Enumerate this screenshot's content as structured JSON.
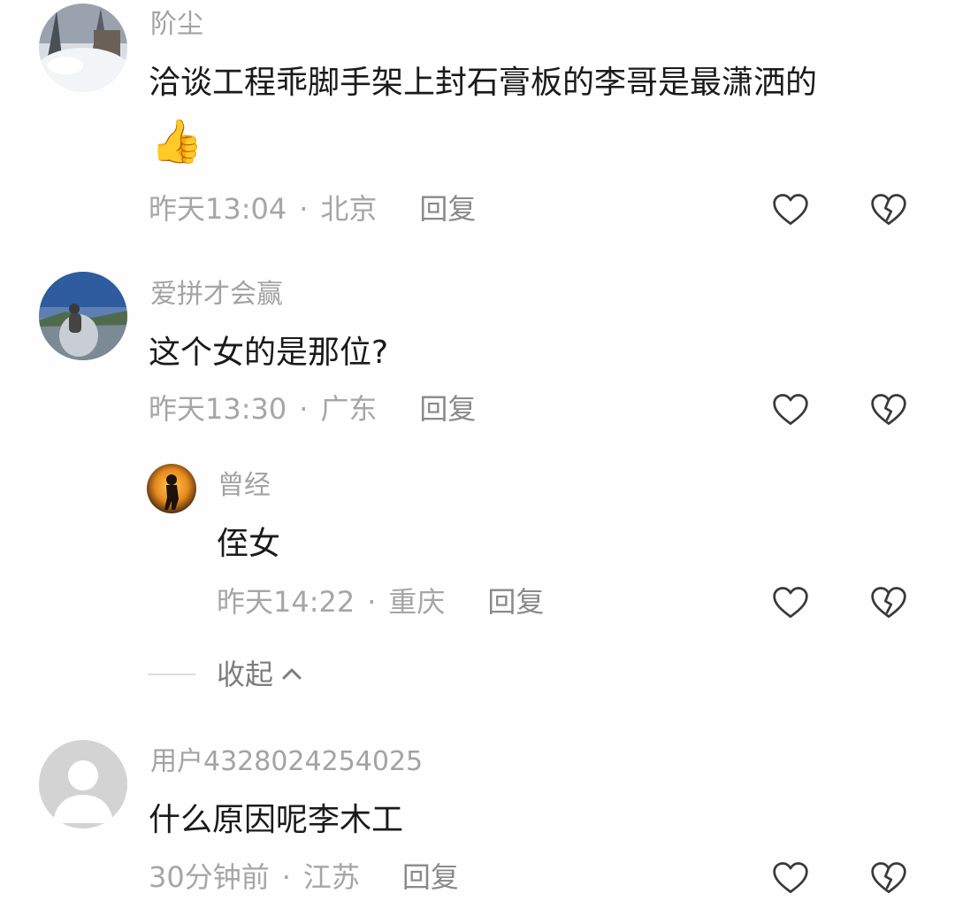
{
  "comments": [
    {
      "username": "阶尘",
      "text": "洽谈工程乖脚手架上封石膏板的李哥是最潇洒的",
      "emoji": "👍",
      "time": "昨天13:04",
      "location": "北京",
      "reply_label": "回复"
    },
    {
      "username": "爱拼才会赢",
      "text": "这个女的是那位?",
      "time": "昨天13:30",
      "location": "广东",
      "reply_label": "回复"
    },
    {
      "username": "曾经",
      "text": "侄女",
      "time": "昨天14:22",
      "location": "重庆",
      "reply_label": "回复"
    },
    {
      "username": "用户4328024254025",
      "text": "什么原因呢李木工",
      "time": "30分钟前",
      "location": "江苏",
      "reply_label": "回复"
    }
  ],
  "meta_separator": "·",
  "collapse_label": "收起",
  "icons": {
    "like": "heart-outline-icon",
    "dislike": "broken-heart-icon",
    "collapse": "chevron-up-icon"
  },
  "colors": {
    "text_primary": "#1a1a1a",
    "text_secondary": "#a6a6a6",
    "icon_stroke": "#3a3a3a"
  }
}
